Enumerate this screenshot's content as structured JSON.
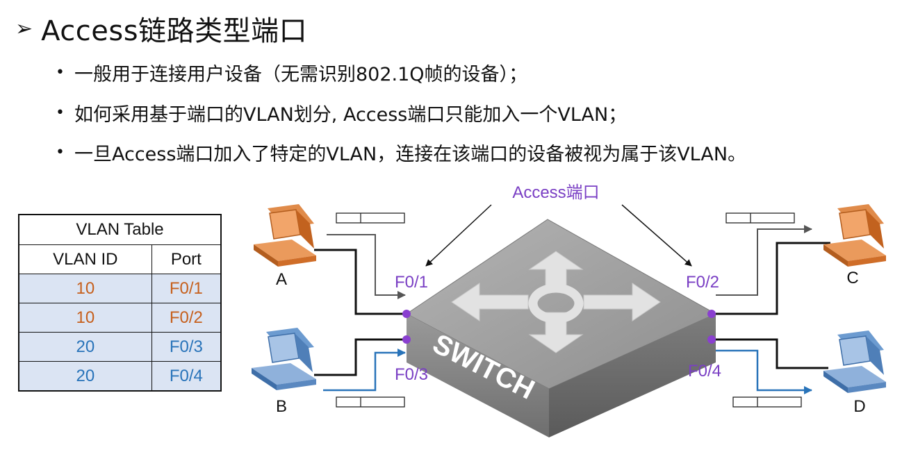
{
  "title": {
    "arrow": "➢",
    "text": "Access链路类型端口"
  },
  "bullets": [
    "一般用于连接用户设备（无需识别802.1Q帧的设备）；",
    "如何采用基于端口的VLAN划分, Access端口只能加入一个VLAN；",
    "一旦Access端口加入了特定的VLAN，连接在该端口的设备被视为属于该VLAN。"
  ],
  "vlan_table": {
    "caption": "VLAN Table",
    "headers": [
      "VLAN ID",
      "Port"
    ],
    "rows": [
      {
        "vlan": "10",
        "port": "F0/1",
        "color": "#c65f1c"
      },
      {
        "vlan": "10",
        "port": "F0/2",
        "color": "#c65f1c"
      },
      {
        "vlan": "20",
        "port": "F0/3",
        "color": "#2873b9"
      },
      {
        "vlan": "20",
        "port": "F0/4",
        "color": "#2873b9"
      }
    ]
  },
  "diagram": {
    "access_label": "Access端口",
    "switch_label": "SWITCH",
    "ports": [
      "F0/1",
      "F0/2",
      "F0/3",
      "F0/4"
    ],
    "hosts": [
      "A",
      "B",
      "C",
      "D"
    ],
    "colors": {
      "accent_purple": "#7a3fc4",
      "vlan10_orange": "#c65f1c",
      "vlan20_blue": "#2873b9",
      "link_black": "#111111",
      "switch_gray": "#8a8a8a"
    }
  }
}
